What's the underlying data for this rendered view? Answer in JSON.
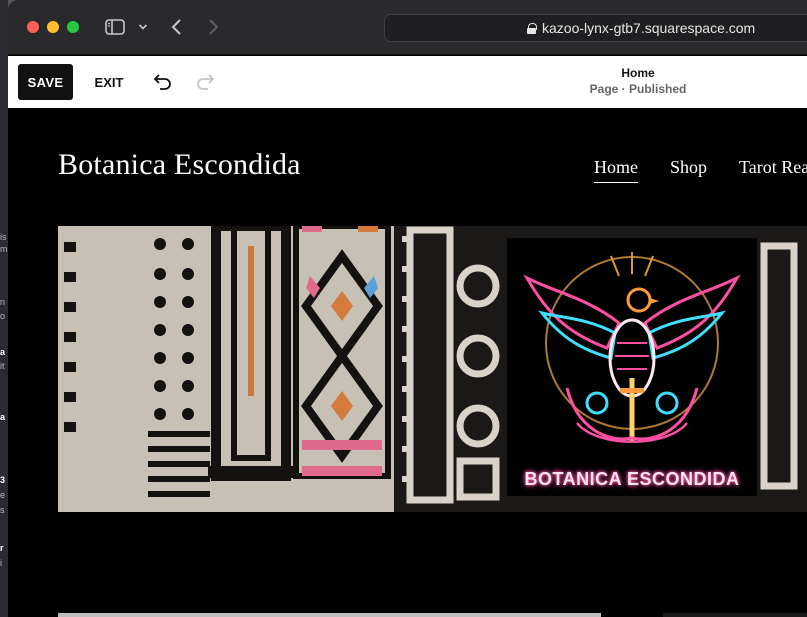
{
  "browser": {
    "url": "kazoo-lynx-gtb7.squarespace.com"
  },
  "editor": {
    "save_label": "SAVE",
    "exit_label": "EXIT",
    "page_title": "Home",
    "page_status": "Page · Published"
  },
  "site": {
    "title": "Botanica Escondida",
    "nav": [
      {
        "label": "Home",
        "active": true
      },
      {
        "label": "Shop",
        "active": false
      },
      {
        "label": "Tarot Rea",
        "active": false
      }
    ],
    "logo_text": "BOTANICA ESCONDIDA"
  },
  "background_window": {
    "fragments": [
      "is",
      "m",
      "n",
      "o",
      "a",
      "it",
      "a",
      "3",
      "e",
      "s",
      "r",
      "i"
    ]
  },
  "colors": {
    "save_bg": "#111111",
    "neon_pink": "#ff4fa3",
    "neon_cyan": "#3fe0ff",
    "neon_orange": "#ff9a3c"
  }
}
